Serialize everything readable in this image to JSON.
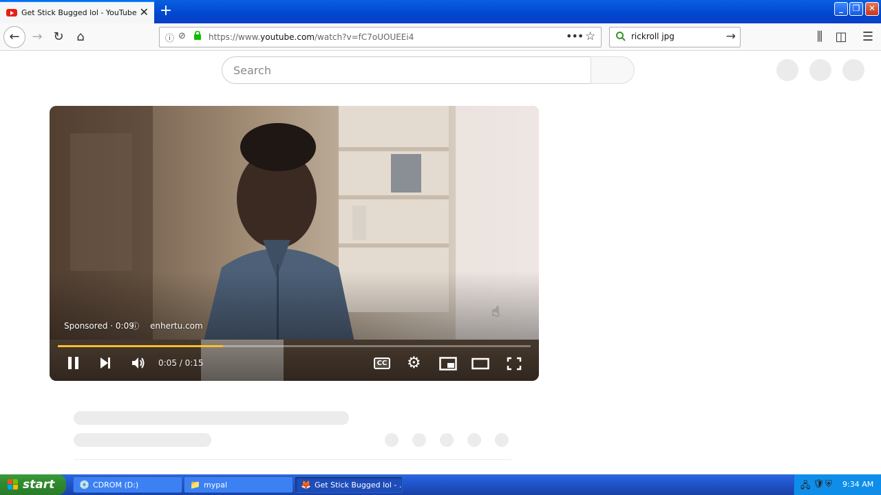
{
  "browser": {
    "tab": {
      "title": "Get Stick Bugged lol - YouTube",
      "close": "✕"
    },
    "new_tab": "+",
    "window": {
      "minimize": "_",
      "maximize": "❐",
      "close": "✕"
    },
    "nav": {
      "back": "←",
      "forward": "→",
      "reload": "↻",
      "home": "⌂"
    },
    "url": {
      "prefix": "https://www.",
      "domain": "youtube.com",
      "path": "/watch?v=fC7oUOUEEi4"
    },
    "url_icons": {
      "info": "ⓘ",
      "tracking": "⊘",
      "lock": "🔒",
      "more": "•••",
      "star": "☆"
    },
    "search": {
      "value": "rickroll jpg",
      "go": "→"
    },
    "toolbar": {
      "library": "⫼",
      "sidebar": "◫",
      "menu": "☰"
    }
  },
  "youtube": {
    "search_placeholder": "Search",
    "player": {
      "ad_label": "Sponsored · 0:09",
      "ad_info_icon": "ⓘ",
      "ad_domain": "enhertu.com",
      "time": "0:05 / 0:15",
      "progress": 0.35,
      "controls": {
        "pause": "❚❚",
        "next": "⏭",
        "volume": "🔊",
        "cc": "CC",
        "settings": "⚙",
        "miniplayer": "▣",
        "theater": "▭",
        "fullscreen": "⛶"
      }
    }
  },
  "taskbar": {
    "start": "start",
    "tasks": [
      {
        "label": "CDROM (D:)",
        "icon": "💿"
      },
      {
        "label": "mypal",
        "icon": "📁"
      },
      {
        "label": "Get Stick Bugged lol - ...",
        "icon": "🦊"
      }
    ],
    "clock": "9:34 AM"
  },
  "colors": {
    "accent": "#0a84ff",
    "progress": "#fbc02d",
    "xp_blue": "#245edb",
    "xp_green": "#2f8a2f"
  }
}
